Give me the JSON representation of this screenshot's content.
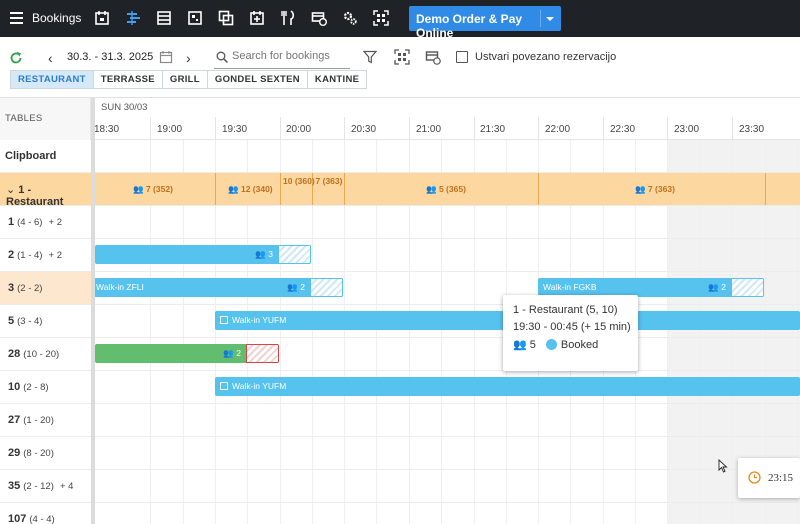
{
  "topbar": {
    "menu_icon": "hamburger-icon",
    "title": "Bookings",
    "icons": [
      "calendar-icon",
      "timeline-icon",
      "list-icon",
      "floorplan-icon",
      "copy-icon",
      "calendar-check-icon",
      "cutlery-icon",
      "payment-icon",
      "settings-icon",
      "qr-scan-icon"
    ],
    "demo_button": "Demo Order & Pay Online",
    "bg_color": "#1f2327",
    "accent": "#2f8be6"
  },
  "toolbar": {
    "date_range": "30.3. - 31.3. 2025",
    "prev": "‹",
    "next": "›",
    "search_placeholder": "Search for bookings",
    "linked_checkbox_label": "Ustvari povezano rezervacijo",
    "areas": [
      "RESTAURANT",
      "TERRASSE",
      "GRILL",
      "GONDEL SEXTEN",
      "KANTINE"
    ],
    "active_area": "RESTAURANT"
  },
  "grid": {
    "tables_header": "TABLES",
    "day_label": "SUN 30/03",
    "times": [
      "18:30",
      "19:00",
      "19:30",
      "20:00",
      "20:30",
      "21:00",
      "21:30",
      "22:00",
      "22:30",
      "23:00",
      "23:30"
    ],
    "rows": [
      {
        "name": "Clipboard",
        "cap": "",
        "extra": ""
      },
      {
        "name": "1 - Restaurant",
        "cap": "",
        "extra": "",
        "expand": "⌄"
      },
      {
        "name": "1",
        "cap": "(4 - 6)",
        "extra": "+ 2"
      },
      {
        "name": "2",
        "cap": "(1 - 4)",
        "extra": "+ 2"
      },
      {
        "name": "3",
        "cap": "(2 - 2)",
        "extra": ""
      },
      {
        "name": "5",
        "cap": "(3 - 4)",
        "extra": ""
      },
      {
        "name": "28",
        "cap": "(10 - 20)",
        "extra": ""
      },
      {
        "name": "10",
        "cap": "(2 - 8)",
        "extra": ""
      },
      {
        "name": "27",
        "cap": "(1 - 20)",
        "extra": ""
      },
      {
        "name": "29",
        "cap": "(8 - 20)",
        "extra": ""
      },
      {
        "name": "35",
        "cap": "(2 - 12)",
        "extra": "+ 4"
      },
      {
        "name": "107",
        "cap": "(4 - 4)",
        "extra": ""
      }
    ],
    "group_segments": [
      "7 (352)",
      "12 (340)",
      "10 (360)",
      "7 (363)",
      "5 (365)",
      "7 (363)"
    ],
    "bookings": {
      "row2_guests": "3",
      "row3a_label": "Walk-in ZFLI",
      "row3a_guests": "2",
      "row3b_label": "Walk-in FGKB",
      "row3b_guests": "2",
      "row5_label": "Walk-in YUFM",
      "row28_guests": "2",
      "row10_label": "Walk-in YUFM"
    }
  },
  "tooltip": {
    "line1": "1 - Restaurant (5, 10)",
    "line2": "19:30 - 00:45 (+ 15 min)",
    "guests": "5",
    "status": "Booked",
    "status_color": "#56c2ee"
  },
  "time_popup": {
    "time": "23:15"
  }
}
